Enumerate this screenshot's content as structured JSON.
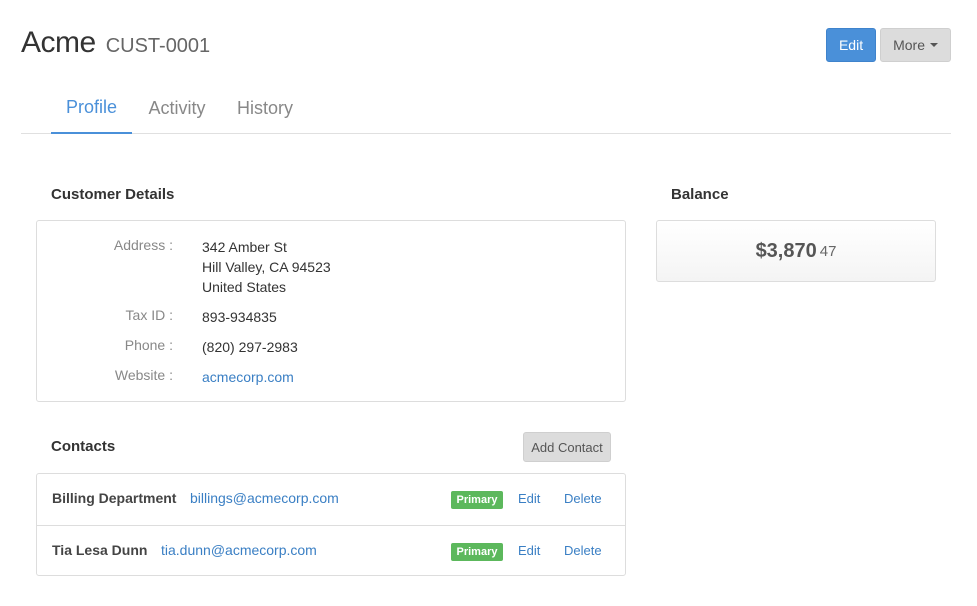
{
  "customer": {
    "name": "Acme",
    "id": "CUST-0001"
  },
  "actions": {
    "edit_label": "Edit",
    "more_label": "More"
  },
  "tabs": [
    {
      "label": "Profile",
      "active": true
    },
    {
      "label": "Activity",
      "active": false
    },
    {
      "label": "History",
      "active": false
    }
  ],
  "details": {
    "title": "Customer Details",
    "address_label": "Address :",
    "address_line1": "342 Amber St",
    "address_line2": "Hill Valley, CA 94523",
    "address_line3": "United States",
    "tax_label": "Tax ID :",
    "tax_value": "893-934835",
    "phone_label": "Phone :",
    "phone_value": "(820) 297-2983",
    "website_label": "Website :",
    "website_value": "acmecorp.com"
  },
  "balance": {
    "title": "Balance",
    "amount": "$3,870",
    "cents": "47"
  },
  "contacts": {
    "title": "Contacts",
    "add_label": "Add Contact",
    "items": [
      {
        "name": "Billing Department",
        "email": "billings@acmecorp.com",
        "badge": "Primary",
        "edit": "Edit",
        "delete": "Delete"
      },
      {
        "name": "Tia Lesa Dunn",
        "email": "tia.dunn@acmecorp.com",
        "badge": "Primary",
        "edit": "Edit",
        "delete": "Delete"
      }
    ]
  },
  "colors": {
    "accent": "#4a90d9",
    "primary_badge": "#5cb85c",
    "link": "#3a7fc4"
  }
}
